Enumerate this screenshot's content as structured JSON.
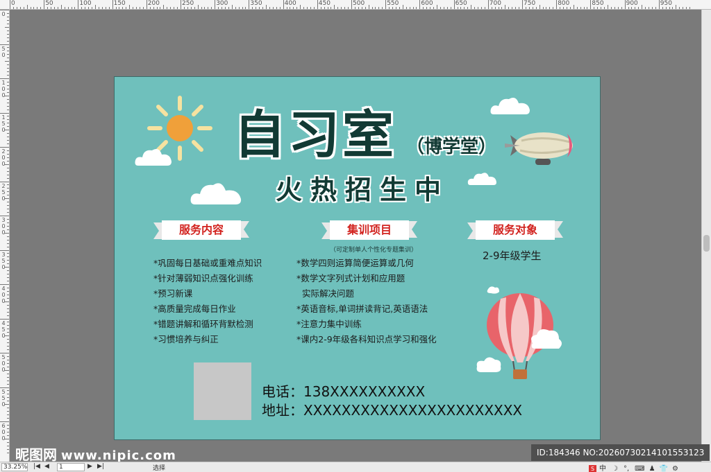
{
  "ruler": {
    "top_labels": [
      "0",
      "50",
      "100",
      "150",
      "200",
      "250",
      "300",
      "350",
      "400",
      "450",
      "500",
      "550",
      "600",
      "650",
      "700",
      "750",
      "800",
      "850",
      "900",
      "950"
    ],
    "left_labels": [
      "0",
      "5\n0",
      "1\n0\n0",
      "1\n5\n0",
      "2\n0\n0",
      "2\n5\n0",
      "3\n0\n0",
      "3\n5\n0",
      "4\n0\n0",
      "4\n5\n0",
      "5\n0\n0",
      "5\n5\n0",
      "6\n0\n0"
    ]
  },
  "flyer": {
    "title": "自习室",
    "subtitle": "（博学堂）",
    "slogan": "火热招生中",
    "sections": {
      "service_content": {
        "label": "服务内容",
        "items": [
          "*巩固每日基础或重难点知识",
          "*针对薄弱知识点强化训练",
          "*预习新课",
          "*高质量完成每日作业",
          "*错题讲解和循环背默检测",
          "*习惯培养与纠正"
        ]
      },
      "training": {
        "label": "集训项目",
        "note": "（可定制单人个性化专题集训）",
        "items": [
          "*数学四则运算简便运算或几何",
          "*数学文字列式计划和应用题",
          "  实际解决问题",
          "*英语音标,单词拼读背记,英语语法",
          "*注意力集中训练",
          "*课内2-9年级各科知识点学习和强化"
        ]
      },
      "audience": {
        "label": "服务对象",
        "value": "2-9年级学生"
      }
    },
    "contact": {
      "phone": "电话：138XXXXXXXXXX",
      "address": "地址：XXXXXXXXXXXXXXXXXXXXXXX"
    },
    "colors": {
      "background": "#6fc0bc",
      "title": "#123a34",
      "ribbon_text": "#d2231f",
      "sun": "#f0a03a",
      "sun_rays": "#f6e2a0"
    }
  },
  "watermark": {
    "brand": "昵图网",
    "url": "www.nipic.com",
    "id_text": "ID:184346 NO:20260730214101553123"
  },
  "statusbar": {
    "zoom": "33.25%",
    "page": "1",
    "tool": "选择",
    "ime": [
      "中",
      "☽",
      "°,",
      "⌨",
      "♟",
      "👕",
      "⚙"
    ]
  }
}
